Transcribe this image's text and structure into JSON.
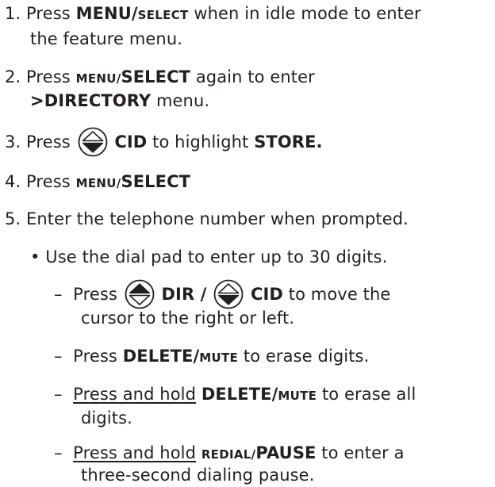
{
  "steps": {
    "s1": {
      "num": "1.",
      "press": "Press",
      "key_a": "MENU/",
      "key_b": "SELECT",
      "rest": "when in idle mode to enter",
      "cont": "the feature menu."
    },
    "s2": {
      "num": "2.",
      "press": "Press",
      "key_a": "MENU/",
      "key_b": "SELECT",
      "rest": "again to enter",
      "menu": ">DIRECTORY",
      "cont": "menu."
    },
    "s3": {
      "num": "3.",
      "press": "Press",
      "key": "CID",
      "rest": "to highlight",
      "target": "STORE."
    },
    "s4": {
      "num": "4.",
      "press": "Press",
      "key_a": "MENU/",
      "key_b": "SELECT"
    },
    "s5": {
      "num": "5.",
      "text": "Enter the telephone number when prompted."
    }
  },
  "bullet": {
    "mark": "•",
    "text": "Use the dial pad to enter up to 30 digits."
  },
  "subs": {
    "a": {
      "dash": "–",
      "press": "Press",
      "key1": "DIR /",
      "key2": "CID",
      "rest": "to move the",
      "cont": "cursor to the right or left."
    },
    "b": {
      "dash": "–",
      "press": "Press",
      "key_a": "DELETE/",
      "key_b": "MUTE",
      "rest": "to erase digits."
    },
    "c": {
      "dash": "–",
      "press_hold": "Press and hold",
      "key_a": "DELETE/",
      "key_b": "MUTE",
      "rest": "to erase all",
      "cont": "digits."
    },
    "d": {
      "dash": "–",
      "press_hold": "Press and hold",
      "key_a": "REDIAL/",
      "key_b": "PAUSE",
      "rest": "to enter a",
      "cont": "three-second dialing pause."
    }
  },
  "icons": {
    "up": "navigation-up-filled-icon",
    "down": "navigation-down-filled-icon"
  },
  "colors": {
    "text": "#231f20"
  }
}
